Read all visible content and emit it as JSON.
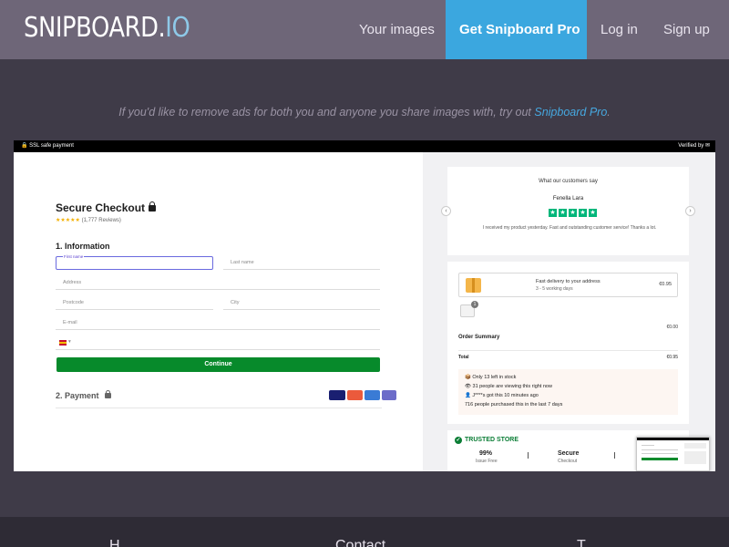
{
  "header": {
    "logo_main": "SNIPBOARD.",
    "logo_io": "IO",
    "nav": {
      "your_images": "Your images",
      "get_pro": "Get Snipboard Pro",
      "log_in": "Log in",
      "sign_up": "Sign up"
    }
  },
  "promo": {
    "text": "If you'd like to remove ads for both you and anyone you share images with, try out ",
    "link": "Snipboard Pro",
    "end": "."
  },
  "screenshot": {
    "topbar_left": "🔒 SSL safe payment",
    "topbar_right": "Verified by ✉",
    "checkout": {
      "title": "Secure Checkout",
      "rating_stars": "★★★★★",
      "rating_reviews": "(1,777 Reviews)",
      "section_information": "1. Information",
      "fields": {
        "first_name": "First name",
        "last_name": "Last name",
        "address": "Address",
        "postcode": "Postcode",
        "city": "City",
        "email": "E-mail"
      },
      "phone_prefix": "▾",
      "continue_label": "Continue",
      "section_payment": "2. Payment",
      "cards": [
        "VISA",
        "MC",
        "Maestro",
        "MC"
      ]
    },
    "testimonial": {
      "heading": "What our customers say",
      "name": "Fenella Lara",
      "stars": [
        "★",
        "★",
        "★",
        "★",
        "★"
      ],
      "text": "I received my product yesterday. Fast and outstanding customer service! Thanks a lot.",
      "prev": "‹",
      "next": "›"
    },
    "order": {
      "shipping_title": "Fast delivery to your address",
      "shipping_eta": "3 - 5 working days",
      "shipping_price": "€0.95",
      "subtotal_price": "€0.00",
      "summary_title": "Order Summary",
      "total_label": "Total",
      "total_price": "€0.95",
      "urgency": [
        "📦 Only 13 left in stock",
        "👁 31 people are viewing this right now",
        "👤 J****s got this 10 minutes ago",
        "716 people purchased this in the last 7 days"
      ]
    },
    "trusted": {
      "heading": "TRUSTED STORE",
      "check": "✓",
      "stat1_value": "99%",
      "stat1_label": "Issue Free",
      "stat2_value": "Secure",
      "stat2_label": "Checkout"
    }
  },
  "footer": {
    "col1": "H",
    "col2": "Contact",
    "col3": "T"
  },
  "colors": {
    "page_bg": "#3f3b48",
    "header_bg": "#6e6678",
    "pro_button": "#3ba7df",
    "continue_green": "#078a2b",
    "trustpilot_green": "#00b67a"
  }
}
